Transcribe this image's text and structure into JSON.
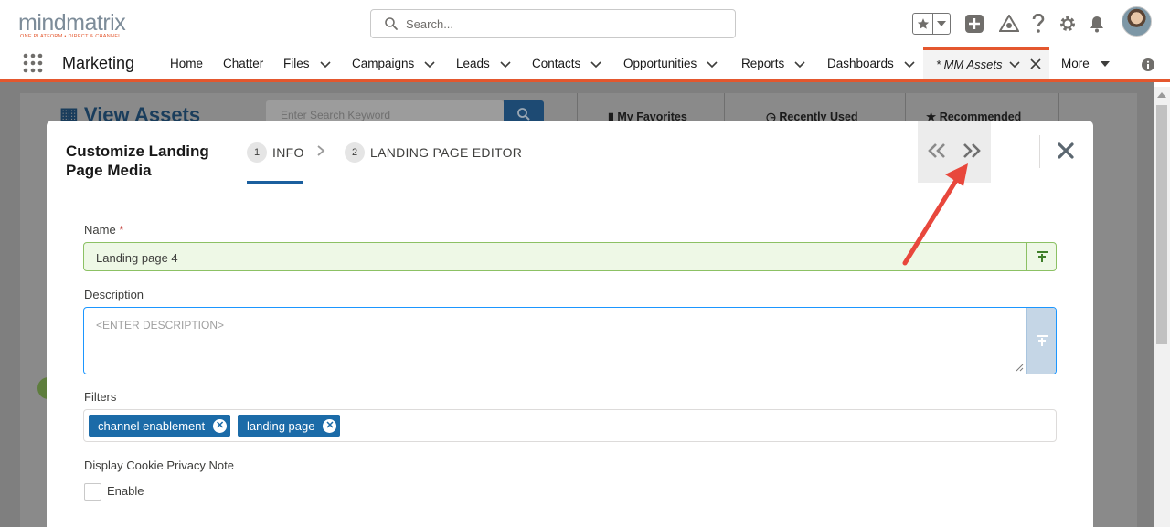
{
  "header": {
    "logo_text": "mindmatrix",
    "logo_tagline": "ONE PLATFORM • DIRECT & CHANNEL",
    "search_placeholder": "Search..."
  },
  "nav": {
    "app_name": "Marketing",
    "items": [
      {
        "label": "Home",
        "has_menu": false
      },
      {
        "label": "Chatter",
        "has_menu": false
      },
      {
        "label": "Files",
        "has_menu": true
      },
      {
        "label": "Campaigns",
        "has_menu": true
      },
      {
        "label": "Leads",
        "has_menu": true
      },
      {
        "label": "Contacts",
        "has_menu": true
      },
      {
        "label": "Opportunities",
        "has_menu": true
      },
      {
        "label": "Reports",
        "has_menu": true
      },
      {
        "label": "Dashboards",
        "has_menu": true
      }
    ],
    "active_tab": "* MM Assets",
    "more_label": "More"
  },
  "background": {
    "page_title": "View Assets",
    "search_placeholder": "Enter Search Keyword",
    "tabs": [
      "My Favorites",
      "Recently Used",
      "Recommended"
    ]
  },
  "modal": {
    "title": "Customize Landing Page Media",
    "steps": [
      {
        "number": "1",
        "label": "INFO",
        "active": true
      },
      {
        "number": "2",
        "label": "LANDING PAGE EDITOR",
        "active": false
      }
    ],
    "fields": {
      "name": {
        "label": "Name",
        "required_mark": "*",
        "value": "Landing page 4"
      },
      "description": {
        "label": "Description",
        "placeholder": "<ENTER DESCRIPTION>"
      },
      "filters": {
        "label": "Filters",
        "tags": [
          "channel enablement",
          "landing page"
        ]
      },
      "cookie": {
        "label": "Display Cookie Privacy Note",
        "checkbox_label": "Enable",
        "checked": false
      }
    }
  },
  "colors": {
    "brand_accent": "#e4572e",
    "primary_blue": "#1b6ba8",
    "annotation_arrow": "#e8473c"
  }
}
